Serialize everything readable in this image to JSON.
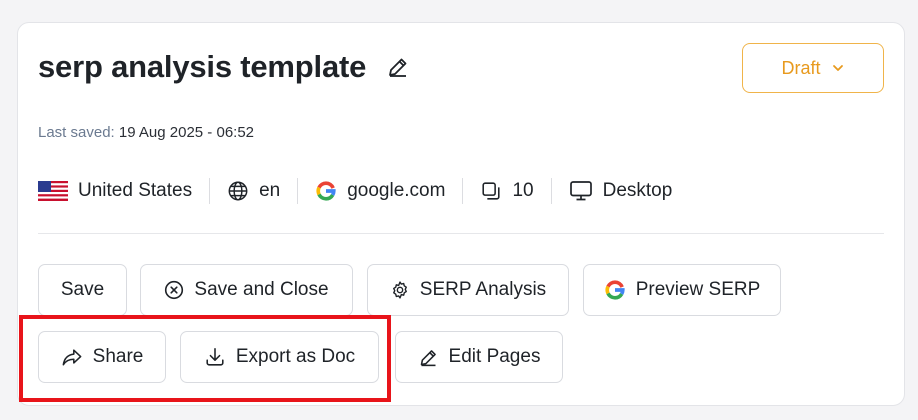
{
  "header": {
    "title": "serp analysis template",
    "status": "Draft"
  },
  "last_saved": {
    "label": "Last saved:",
    "value": "19 Aug 2025 - 06:52"
  },
  "meta": {
    "country": "United States",
    "language": "en",
    "search_engine": "google.com",
    "result_count": "10",
    "device": "Desktop"
  },
  "actions": {
    "save": "Save",
    "save_and_close": "Save and Close",
    "serp_analysis": "SERP Analysis",
    "preview_serp": "Preview SERP",
    "share": "Share",
    "export_doc": "Export as Doc",
    "edit_pages": "Edit Pages"
  },
  "colors": {
    "draft_accent": "#e89a1e",
    "highlight": "#e8141a"
  },
  "icons": {
    "edit_title": "pencil-icon",
    "status": "chevron-down-icon",
    "country": "us-flag-icon",
    "language": "globe-icon",
    "search_engine": "google-icon",
    "result_count": "copy-icon",
    "device": "monitor-icon",
    "save_and_close": "close-circle-icon",
    "serp_analysis": "gear-icon",
    "preview_serp": "google-icon",
    "share": "share-icon",
    "export_doc": "download-icon",
    "edit_pages": "pencil-icon"
  }
}
